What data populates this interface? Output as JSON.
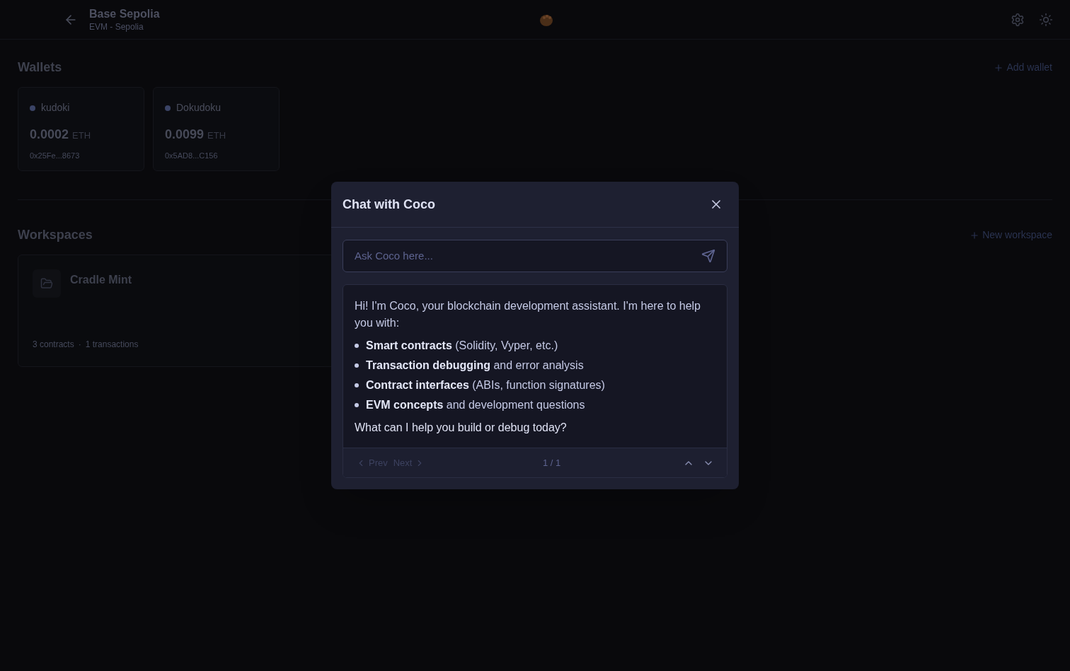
{
  "header": {
    "title": "Base Sepolia",
    "subtitle": "EVM - Sepolia"
  },
  "wallets": {
    "title": "Wallets",
    "add_label": "Add wallet",
    "items": [
      {
        "name": "kudoki",
        "balance": "0.0002",
        "unit": "ETH",
        "address": "0x25Fe...8673",
        "color": "#3b4466"
      },
      {
        "name": "Dokudoku",
        "balance": "0.0099",
        "unit": "ETH",
        "address": "0x5AD8...C156",
        "color": "#3b4466"
      }
    ]
  },
  "workspaces": {
    "title": "Workspaces",
    "add_label": "New workspace",
    "items": [
      {
        "name": "Cradle Mint",
        "contracts": "3 contracts",
        "separator": "·",
        "transactions": "1 transactions"
      }
    ]
  },
  "dialog": {
    "title": "Chat with Coco",
    "input": {
      "placeholder": "Ask Coco here..."
    },
    "message": {
      "intro": "Hi! I'm Coco, your blockchain development assistant. I'm here to help you with:",
      "bullets": [
        "**Smart contracts** (Solidity, Vyper, etc.)",
        "**Transaction debugging** and error analysis",
        "**Contract interfaces** (ABIs, function signatures)",
        "**EVM concepts** and development questions"
      ],
      "outro": "What can I help you build or debug today?"
    },
    "pager": {
      "prev": {
        "label": "Prev",
        "disabled": true
      },
      "next": {
        "label": "Next",
        "disabled": true
      },
      "count": "1 / 1"
    }
  }
}
